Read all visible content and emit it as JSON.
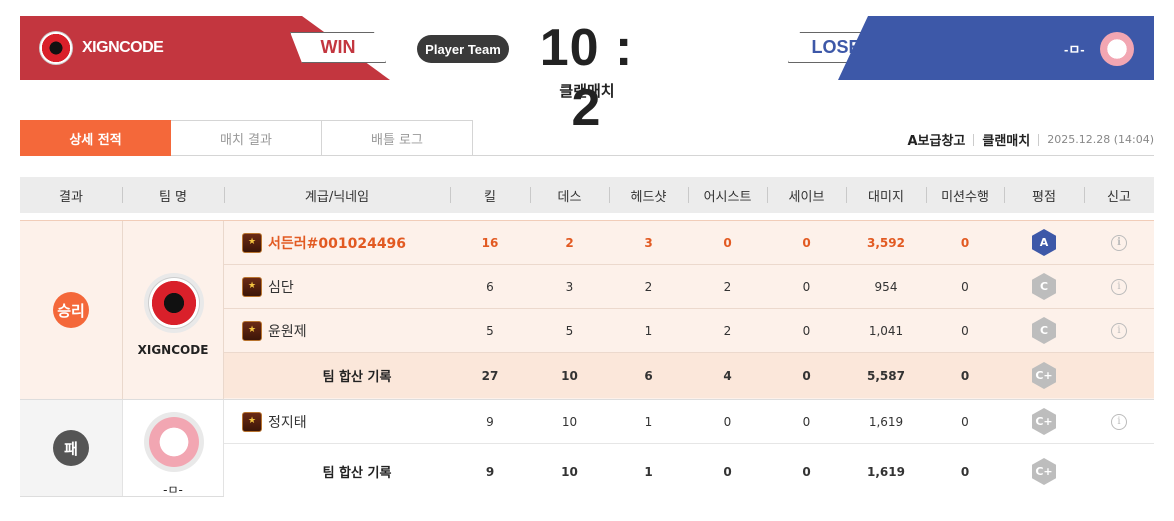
{
  "header": {
    "left_team": "XIGNCODE",
    "left_result": "WIN",
    "right_team": "-ㅁ-",
    "right_result": "LOSE",
    "player_team_label": "Player Team",
    "score": "10 : 2",
    "match_type": "클랜매치",
    "colors": {
      "win": "#c3363f",
      "lose": "#3d58a8",
      "accent": "#f4683a"
    }
  },
  "tabs": [
    {
      "label": "상세 전적",
      "active": true
    },
    {
      "label": "매치 결과",
      "active": false
    },
    {
      "label": "배틀 로그",
      "active": false
    }
  ],
  "meta": {
    "map": "A보급창고",
    "mode": "클랜매치",
    "date": "2025.12.28 (14:04)"
  },
  "columns": [
    "결과",
    "팀 명",
    "계급/닉네임",
    "킬",
    "데스",
    "헤드샷",
    "어시스트",
    "세이브",
    "대미지",
    "미션수행",
    "평점",
    "신고"
  ],
  "teams": [
    {
      "result": "승리",
      "name": "XIGNCODE",
      "players": [
        {
          "nick": "서든러#001024496",
          "kill": "16",
          "death": "2",
          "headshot": "3",
          "assist": "0",
          "save": "0",
          "damage": "3,592",
          "mission": "0",
          "grade": "A"
        },
        {
          "nick": "심단",
          "kill": "6",
          "death": "3",
          "headshot": "2",
          "assist": "2",
          "save": "0",
          "damage": "954",
          "mission": "0",
          "grade": "C"
        },
        {
          "nick": "윤원제",
          "kill": "5",
          "death": "5",
          "headshot": "1",
          "assist": "2",
          "save": "0",
          "damage": "1,041",
          "mission": "0",
          "grade": "C"
        }
      ],
      "total": {
        "label": "팀 합산 기록",
        "kill": "27",
        "death": "10",
        "headshot": "6",
        "assist": "4",
        "save": "0",
        "damage": "5,587",
        "mission": "0",
        "grade": "C+"
      }
    },
    {
      "result": "패",
      "name": "-ㅁ-",
      "players": [
        {
          "nick": "정지태",
          "kill": "9",
          "death": "10",
          "headshot": "1",
          "assist": "0",
          "save": "0",
          "damage": "1,619",
          "mission": "0",
          "grade": "C+"
        }
      ],
      "total": {
        "label": "팀 합산 기록",
        "kill": "9",
        "death": "10",
        "headshot": "1",
        "assist": "0",
        "save": "0",
        "damage": "1,619",
        "mission": "0",
        "grade": "C+"
      }
    }
  ],
  "icons": {
    "rank": "rank-badge-icon",
    "report": "info-icon",
    "grade": "hexagon-grade-icon"
  }
}
